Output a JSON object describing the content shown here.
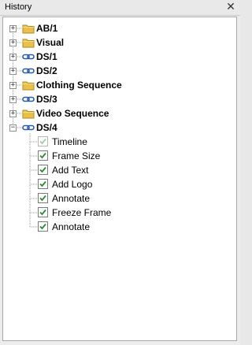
{
  "panel": {
    "title": "History",
    "close_glyph": "✕"
  },
  "tree": {
    "expander_collapsed": "+",
    "expander_expanded": "−",
    "nodes": [
      {
        "label": "AB/1",
        "icon": "folder-icon",
        "expanded": false
      },
      {
        "label": "Visual",
        "icon": "folder-icon",
        "expanded": false
      },
      {
        "label": "DS/1",
        "icon": "link-icon",
        "expanded": false
      },
      {
        "label": "DS/2",
        "icon": "link-icon",
        "expanded": false
      },
      {
        "label": "Clothing Sequence",
        "icon": "folder-icon",
        "expanded": false
      },
      {
        "label": "DS/3",
        "icon": "link-icon",
        "expanded": false
      },
      {
        "label": "Video Sequence",
        "icon": "folder-icon",
        "expanded": false
      },
      {
        "label": "DS/4",
        "icon": "link-icon",
        "expanded": true
      }
    ],
    "children": [
      {
        "label": "Timeline",
        "checked": true,
        "enabled": false
      },
      {
        "label": "Frame Size",
        "checked": true,
        "enabled": true
      },
      {
        "label": "Add Text",
        "checked": true,
        "enabled": true
      },
      {
        "label": "Add Logo",
        "checked": true,
        "enabled": true
      },
      {
        "label": "Annotate",
        "checked": true,
        "enabled": true
      },
      {
        "label": "Freeze Frame",
        "checked": true,
        "enabled": true
      },
      {
        "label": "Annotate",
        "checked": true,
        "enabled": true
      }
    ]
  },
  "colors": {
    "folder": "#e8c04a",
    "link": "#2a5dab",
    "check": "#2e8b2e",
    "check_disabled": "#a8c8a8"
  }
}
